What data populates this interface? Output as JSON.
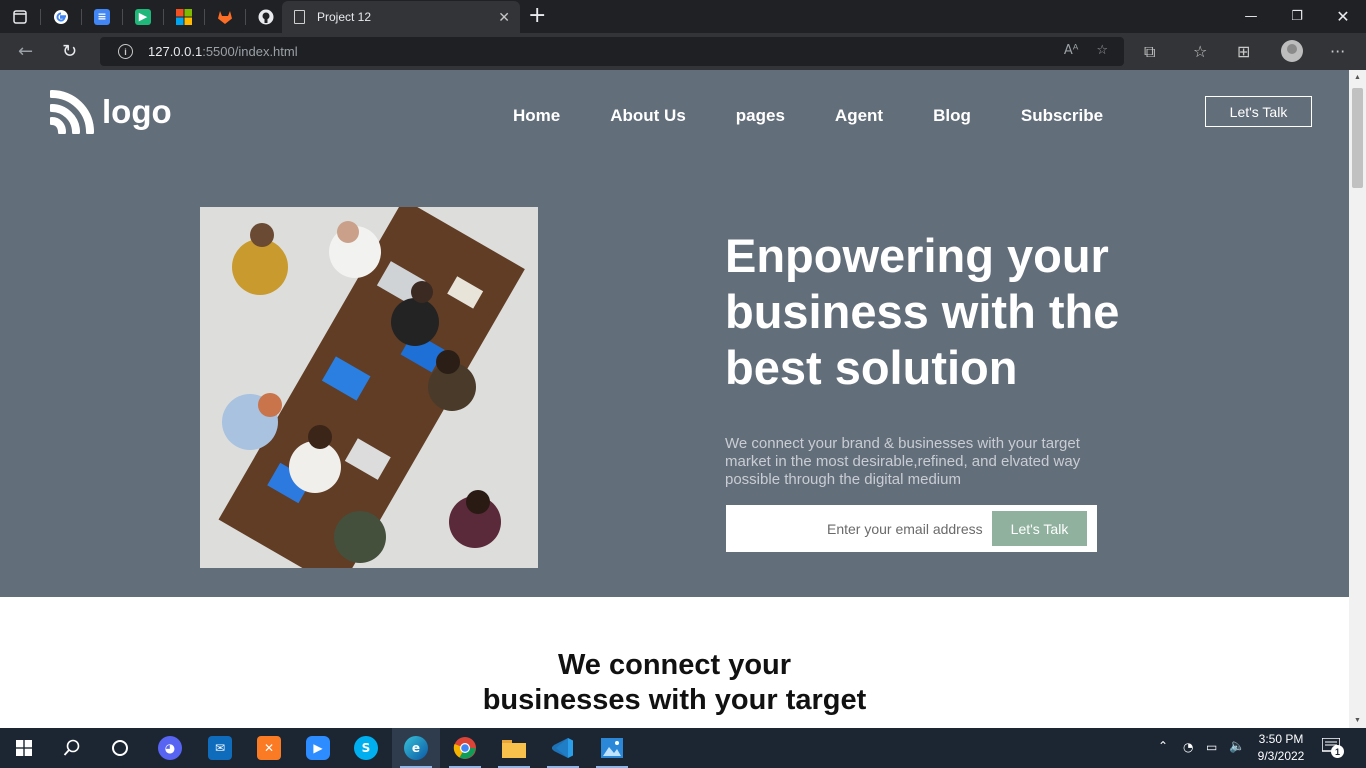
{
  "browser": {
    "tab_title": "Project 12",
    "url_host": "127.0.0.1",
    "url_path": ":5500/index.html",
    "pinned_tabs": [
      "google-icon",
      "docs-icon",
      "play-icon",
      "microsoft-icon",
      "gitlab-icon",
      "github-icon"
    ]
  },
  "site": {
    "logo_text": "logo",
    "nav": [
      {
        "label": "Home"
      },
      {
        "label": "About Us"
      },
      {
        "label": "pages"
      },
      {
        "label": "Agent"
      },
      {
        "label": "Blog"
      },
      {
        "label": "Subscribe"
      }
    ],
    "cta_top": "Let's Talk",
    "hero": {
      "headline": "Enpowering your business with the best solution",
      "subtext": "We connect your brand & businesses with your target market in the most desirable,refined, and elvated way possible through the digital medium",
      "email_placeholder": "Enter your email address",
      "email_button": "Let's Talk"
    },
    "section2": {
      "line1": "We connect your",
      "line2": "businesses with your target"
    },
    "colors": {
      "hero_bg": "#636e7b",
      "button_green": "#8fb19d"
    }
  },
  "taskbar": {
    "apps": [
      "windows-start-icon",
      "search-icon",
      "cortana-icon",
      "discord-icon",
      "mail-icon",
      "xampp-icon",
      "zoom-icon",
      "skype-icon",
      "edge-icon",
      "chrome-icon",
      "file-explorer-icon",
      "vscode-icon",
      "photos-icon"
    ],
    "time": "3:50 PM",
    "date": "9/3/2022",
    "notification_count": "1"
  }
}
